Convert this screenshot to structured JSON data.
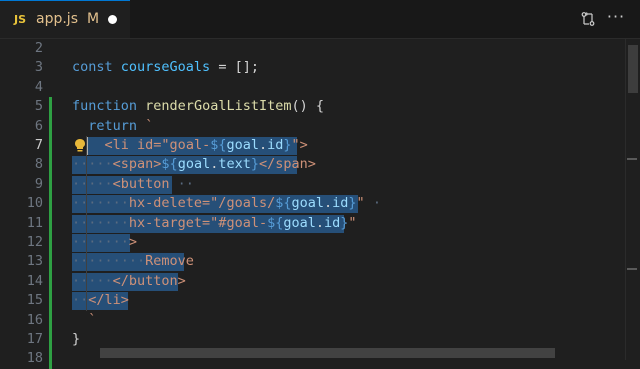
{
  "tab": {
    "icon": "JS",
    "filename": "app.js",
    "status": "M",
    "unsaved": true
  },
  "actions": {
    "compare_icon": "git-compare-icon",
    "more_label": "···"
  },
  "colors": {
    "selection": "#264f78",
    "modified_gutter": "#2ea043",
    "keyword": "#569cd6",
    "function": "#dcdcaa",
    "string": "#ce9178",
    "variable": "#4fc1ff"
  },
  "editor": {
    "current_line": "7",
    "lines": [
      {
        "num": "2",
        "text": ""
      },
      {
        "num": "3",
        "text": "const courseGoals = [];"
      },
      {
        "num": "4",
        "text": ""
      },
      {
        "num": "5",
        "text": "function renderGoalListItem() {"
      },
      {
        "num": "6",
        "text": "  return `"
      },
      {
        "num": "7",
        "text": "    <li id=\"goal-${goal.id}\">"
      },
      {
        "num": "8",
        "text": "      <span>${goal.text}</span>"
      },
      {
        "num": "9",
        "text": "      <button"
      },
      {
        "num": "10",
        "text": "        hx-delete=\"/goals/${goal.id}\""
      },
      {
        "num": "11",
        "text": "        hx-target=\"#goal-${goal.id}\""
      },
      {
        "num": "12",
        "text": "        >"
      },
      {
        "num": "13",
        "text": "          Remove"
      },
      {
        "num": "14",
        "text": "      </button>"
      },
      {
        "num": "15",
        "text": "  </li>"
      },
      {
        "num": "16",
        "text": "  `"
      },
      {
        "num": "17",
        "text": "}"
      },
      {
        "num": "18",
        "text": ""
      }
    ]
  }
}
